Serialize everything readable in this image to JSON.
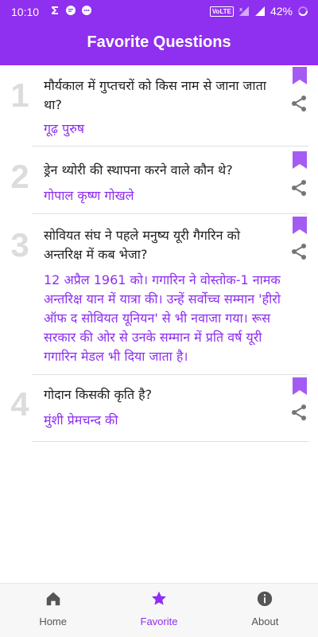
{
  "status_bar": {
    "time": "10:10",
    "network_badge": "VoLTE",
    "battery": "42%"
  },
  "header": {
    "title": "Favorite Questions"
  },
  "questions": [
    {
      "number": "1",
      "question": "मौर्यकाल में गुप्तचरों को किस नाम से जाना जाता था?",
      "answer": "गूढ़ पुरुष"
    },
    {
      "number": "2",
      "question": "ड्रेन थ्योरी की स्थापना करने वाले कौन थे?",
      "answer": "गोपाल कृष्ण गोखले"
    },
    {
      "number": "3",
      "question": "सोवियत संघ ने पहले मनुष्य यूरी गैगरिन को अन्तरिक्ष में कब भेजा?",
      "answer": "12 अप्रैल 1961 को। गगारिन ने वोस्तोक-1 नामक अन्तरिक्ष यान में यात्रा की। उन्हें सर्वोच्च सम्मान 'हीरो ऑफ द सोवियत यूनियन' से भी नवाजा गया। रूस सरकार की ओर से उनके सम्मान में प्रति वर्ष यूरी गगारिन मेडल भी दिया जाता है।"
    },
    {
      "number": "4",
      "question": "गोदान किसकी कृति है?",
      "answer": "मुंशी प्रेमचन्द की"
    }
  ],
  "bottom_nav": {
    "items": [
      {
        "label": "Home",
        "icon": "home-icon",
        "active": false
      },
      {
        "label": "Favorite",
        "icon": "star-icon",
        "active": true
      },
      {
        "label": "About",
        "icon": "info-icon",
        "active": false
      }
    ]
  },
  "colors": {
    "accent": "#8f2ff0",
    "number": "#dcdcdc",
    "text": "#222222",
    "icon_gray": "#757575"
  }
}
